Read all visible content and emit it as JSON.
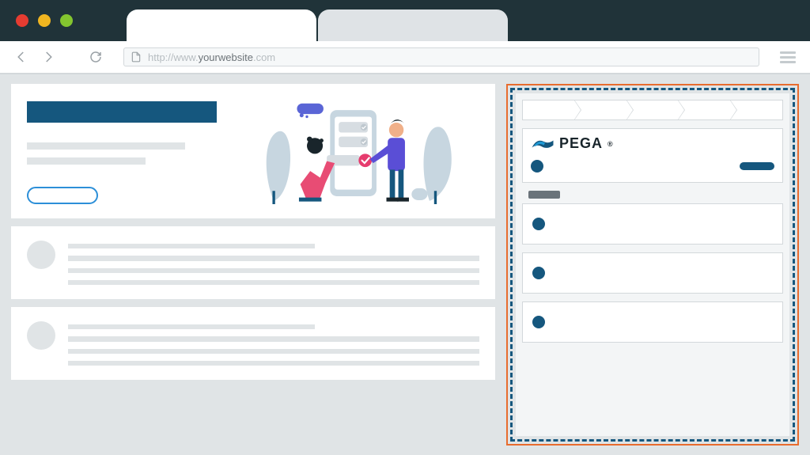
{
  "browser": {
    "url_prefix": "http://www.",
    "url_domain": "yourwebsite",
    "url_suffix": ".com",
    "traffic_lights": {
      "red": "#e63c31",
      "yellow": "#f0b520",
      "green": "#83c52f"
    }
  },
  "sidebar": {
    "brand": "PEGA",
    "brand_mark": "®",
    "colors": {
      "accent": "#15577e",
      "highlight_border": "#e86c2e",
      "dash_border": "#15577e"
    },
    "breadcrumb_steps": 5,
    "list_items": 3
  }
}
